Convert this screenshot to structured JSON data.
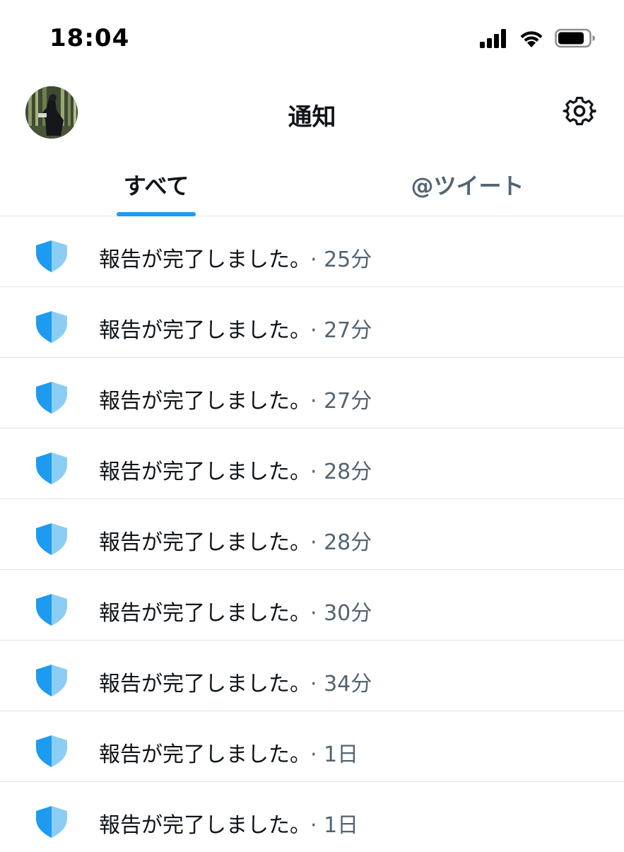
{
  "status_bar": {
    "time": "18:04"
  },
  "header": {
    "title": "通知"
  },
  "tabs": [
    {
      "label": "すべて",
      "selected": true
    },
    {
      "label": "@ツイート",
      "selected": false
    }
  ],
  "colors": {
    "accent": "#1d9bf0",
    "shield_dark": "#1d9bf0",
    "shield_light": "#8ccdf5",
    "secondary_text": "#536471",
    "divider": "#dfe3e6"
  },
  "icons": {
    "settings": "gear-icon",
    "notification": "shield-icon"
  },
  "notifications": [
    {
      "text": "報告が完了しました。",
      "time": "· 25分"
    },
    {
      "text": "報告が完了しました。",
      "time": "· 27分"
    },
    {
      "text": "報告が完了しました。",
      "time": "· 27分"
    },
    {
      "text": "報告が完了しました。",
      "time": "· 28分"
    },
    {
      "text": "報告が完了しました。",
      "time": "· 28分"
    },
    {
      "text": "報告が完了しました。",
      "time": "· 30分"
    },
    {
      "text": "報告が完了しました。",
      "time": "· 34分"
    },
    {
      "text": "報告が完了しました。",
      "time": "· 1日"
    },
    {
      "text": "報告が完了しました。",
      "time": "· 1日"
    }
  ]
}
